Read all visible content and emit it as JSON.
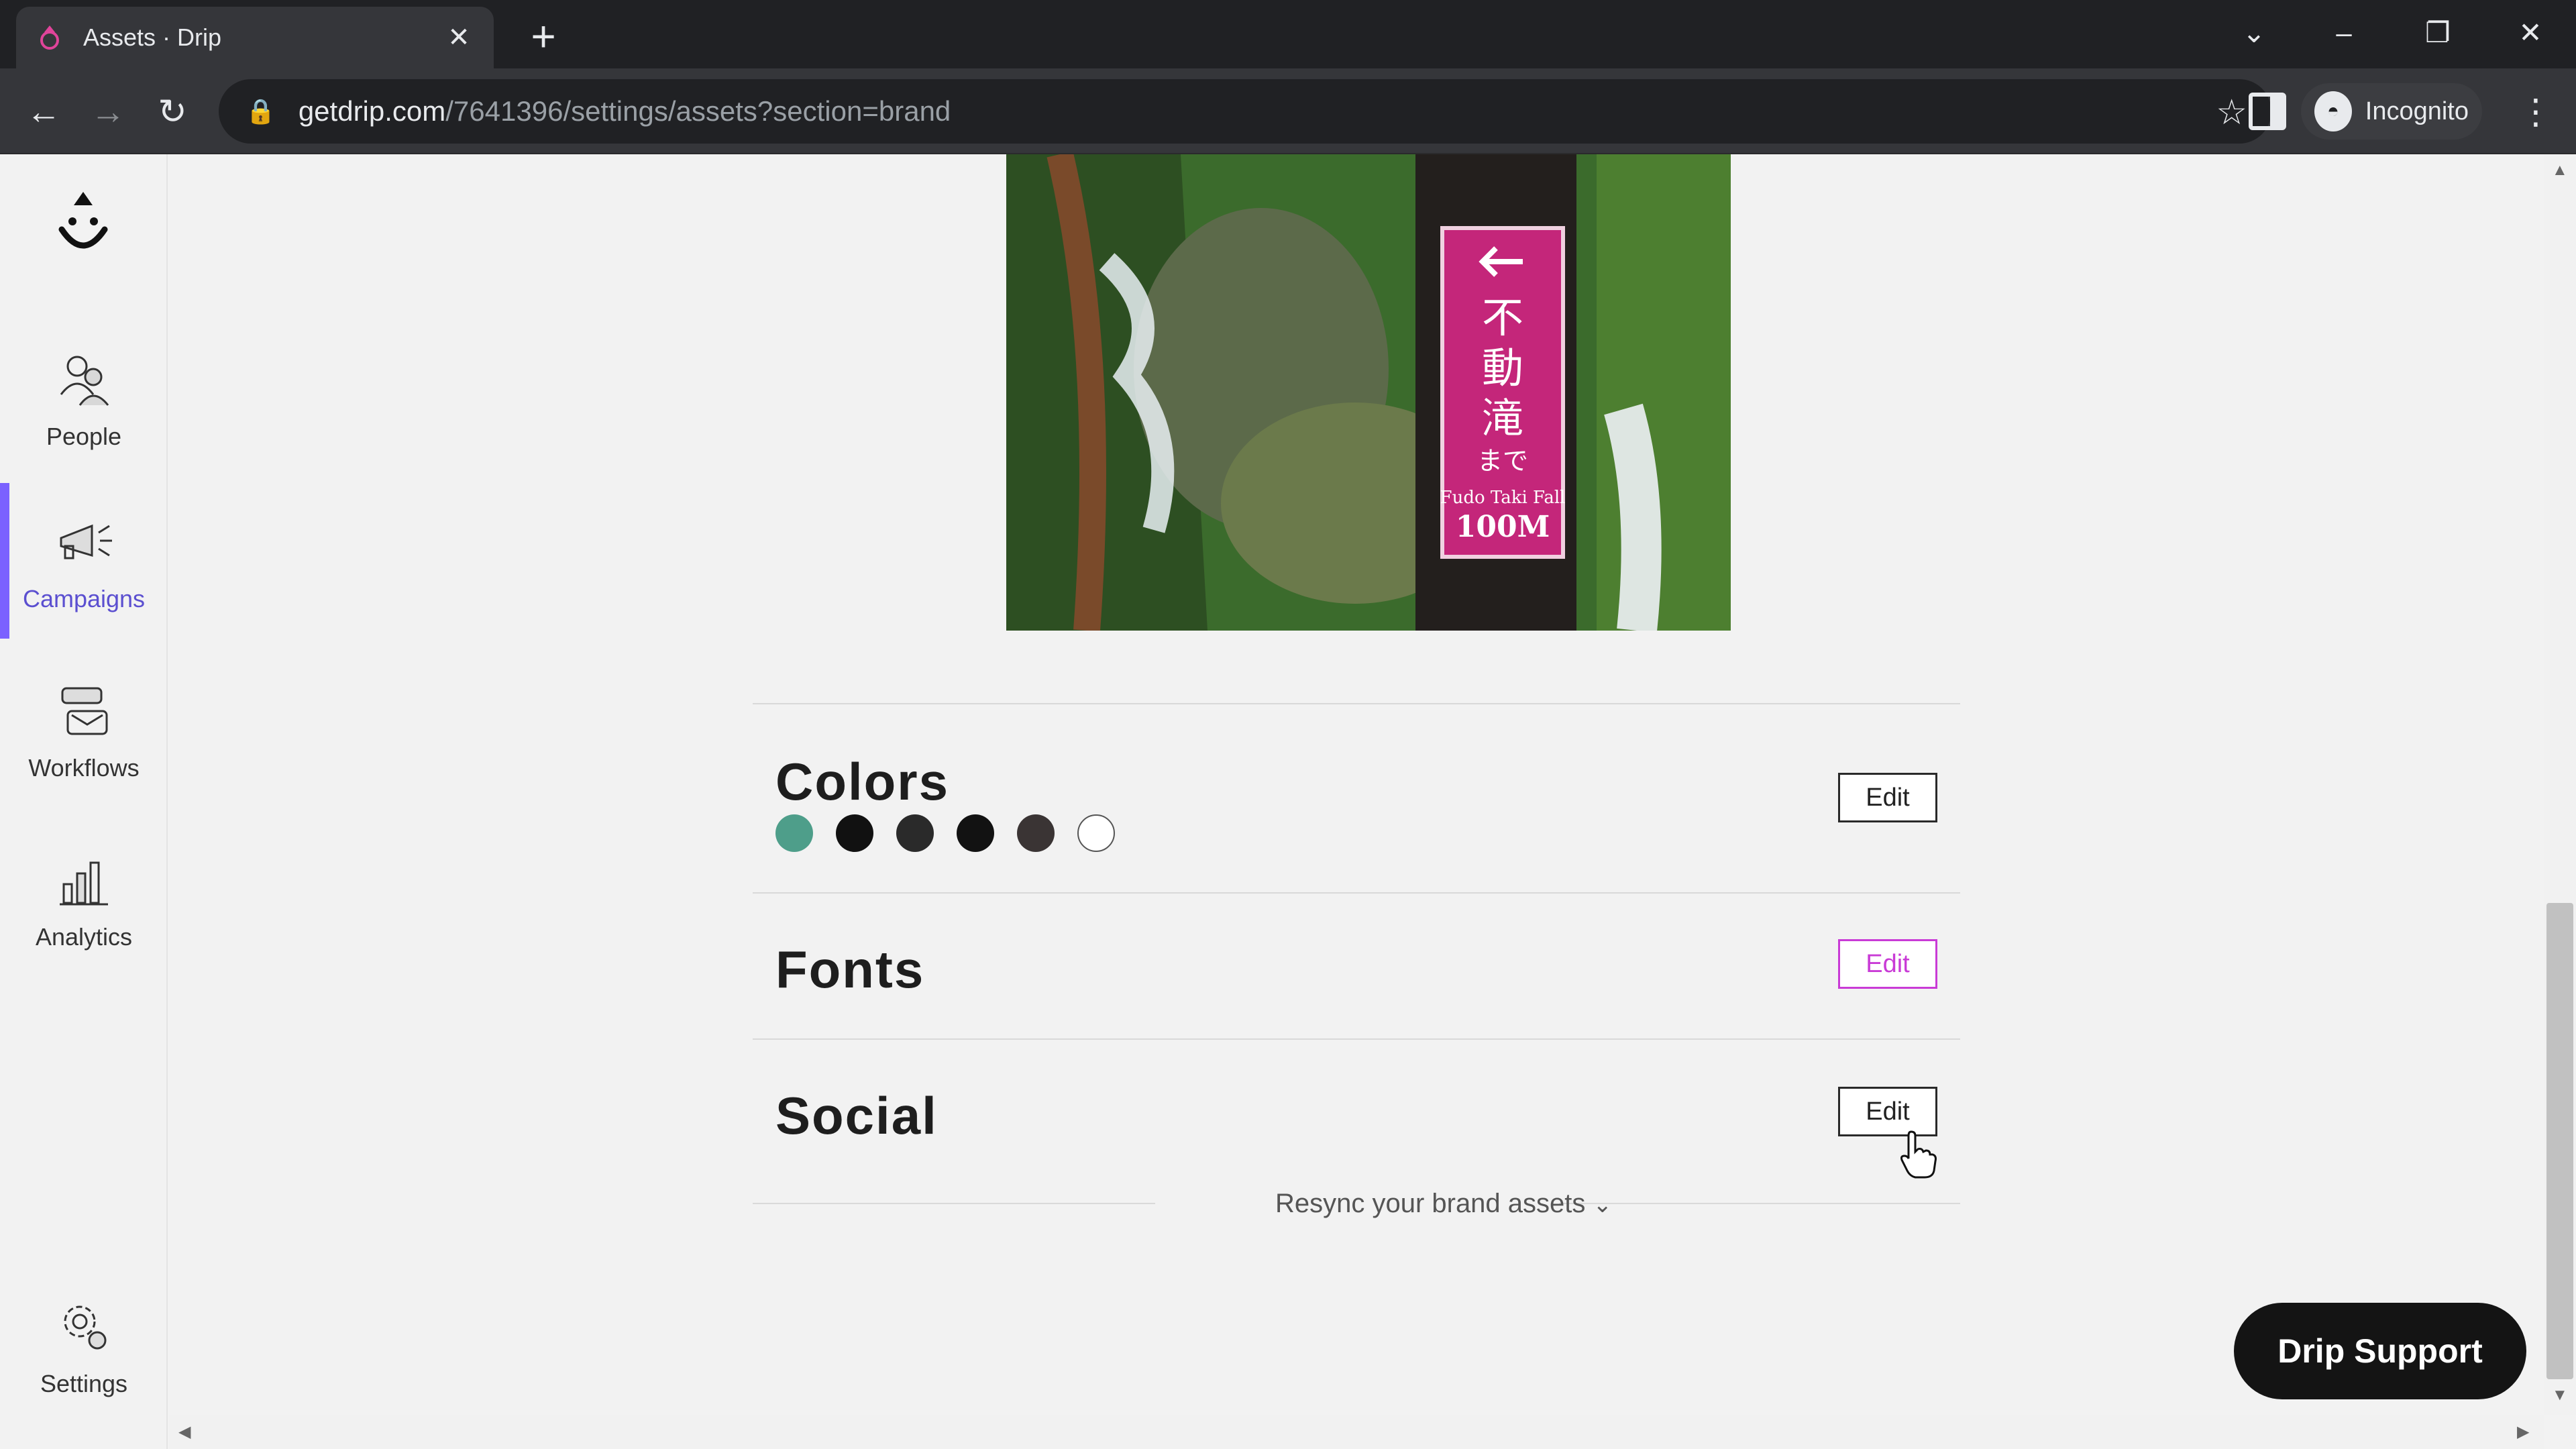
{
  "browser": {
    "tab_title": "Assets · Drip",
    "tab_close": "✕",
    "new_tab": "+",
    "url_host": "getdrip.com",
    "url_path": "/7641396/settings/assets?section=brand",
    "profile_label": "Incognito",
    "window_controls": {
      "dropdown": "⌄",
      "minimize": "–",
      "restore": "❐",
      "close": "✕"
    },
    "nav": {
      "back": "←",
      "forward": "→",
      "reload": "↻",
      "lock": "🔒",
      "star": "☆",
      "menu": "⋮"
    }
  },
  "sidebar": {
    "items": [
      {
        "label": "People",
        "icon": "people-icon"
      },
      {
        "label": "Campaigns",
        "icon": "megaphone-icon",
        "active": true
      },
      {
        "label": "Workflows",
        "icon": "workflow-icon"
      },
      {
        "label": "Analytics",
        "icon": "analytics-icon"
      },
      {
        "label": "Settings",
        "icon": "gear-icon"
      }
    ]
  },
  "hero_image": {
    "sign_lines": [
      "不",
      "動",
      "滝",
      "まで"
    ],
    "sign_caption": "Fudo Taki Fall",
    "sign_distance": "100M"
  },
  "sections": {
    "colors": {
      "title": "Colors",
      "edit_label": "Edit"
    },
    "fonts": {
      "title": "Fonts",
      "edit_label": "Edit"
    },
    "social": {
      "title": "Social",
      "edit_label": "Edit"
    }
  },
  "swatch_colors": [
    "#4e9e8a",
    "#111111",
    "#2a2a2a",
    "#121212",
    "#3a3434",
    "#ffffff"
  ],
  "resync_label": "Resync your brand assets",
  "resync_chevron": "⌄",
  "support_label": "Drip Support",
  "accent_color": "#7b61ff",
  "hover_color": "#c93bd6"
}
